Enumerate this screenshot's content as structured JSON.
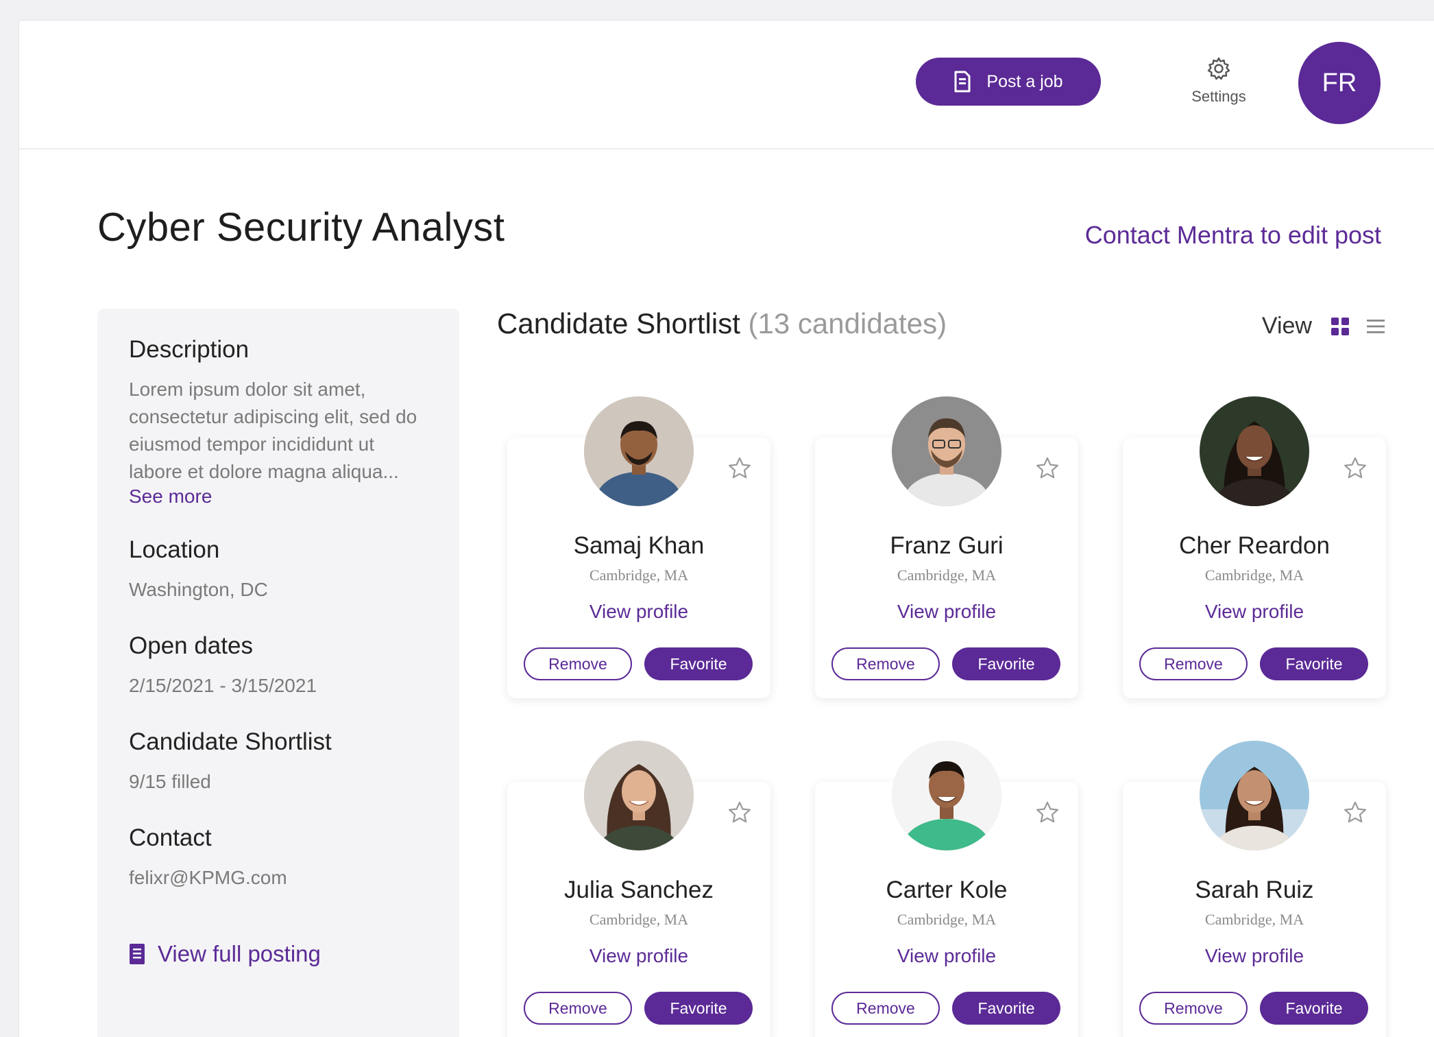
{
  "header": {
    "post_job_label": "Post a job",
    "settings_label": "Settings",
    "user_initials": "FR"
  },
  "job": {
    "title": "Cyber Security Analyst",
    "contact_link": "Contact Mentra to edit post"
  },
  "sidebar": {
    "description_heading": "Description",
    "description_lines": [
      "Lorem ipsum dolor sit amet,",
      "consectetur adipiscing elit, sed do",
      "eiusmod tempor incididunt ut",
      "labore et dolore magna aliqua..."
    ],
    "see_more": "See more",
    "location_heading": "Location",
    "location_value": "Washington, DC",
    "open_dates_heading": "Open dates",
    "open_dates_value": "2/15/2021 - 3/15/2021",
    "shortlist_heading": "Candidate Shortlist",
    "shortlist_value": "9/15 filled",
    "contact_heading": "Contact",
    "contact_value": "felixr@KPMG.com",
    "view_full_posting": "View full posting"
  },
  "shortlist": {
    "title": "Candidate Shortlist",
    "count": "(13 candidates)",
    "view_label": "View"
  },
  "candidate_actions": {
    "view_profile": "View profile",
    "remove": "Remove",
    "favorite": "Favorite"
  },
  "candidates": [
    {
      "name": "Samaj Khan",
      "location": "Cambridge, MA"
    },
    {
      "name": "Franz Guri",
      "location": "Cambridge, MA"
    },
    {
      "name": "Cher Reardon",
      "location": "Cambridge, MA"
    },
    {
      "name": "Julia Sanchez",
      "location": "Cambridge, MA"
    },
    {
      "name": "Carter Kole",
      "location": "Cambridge, MA"
    },
    {
      "name": "Sarah Ruiz",
      "location": "Cambridge, MA"
    }
  ],
  "colors": {
    "brand_purple": "#5b2a96",
    "panel_gray": "#f4f4f6"
  }
}
